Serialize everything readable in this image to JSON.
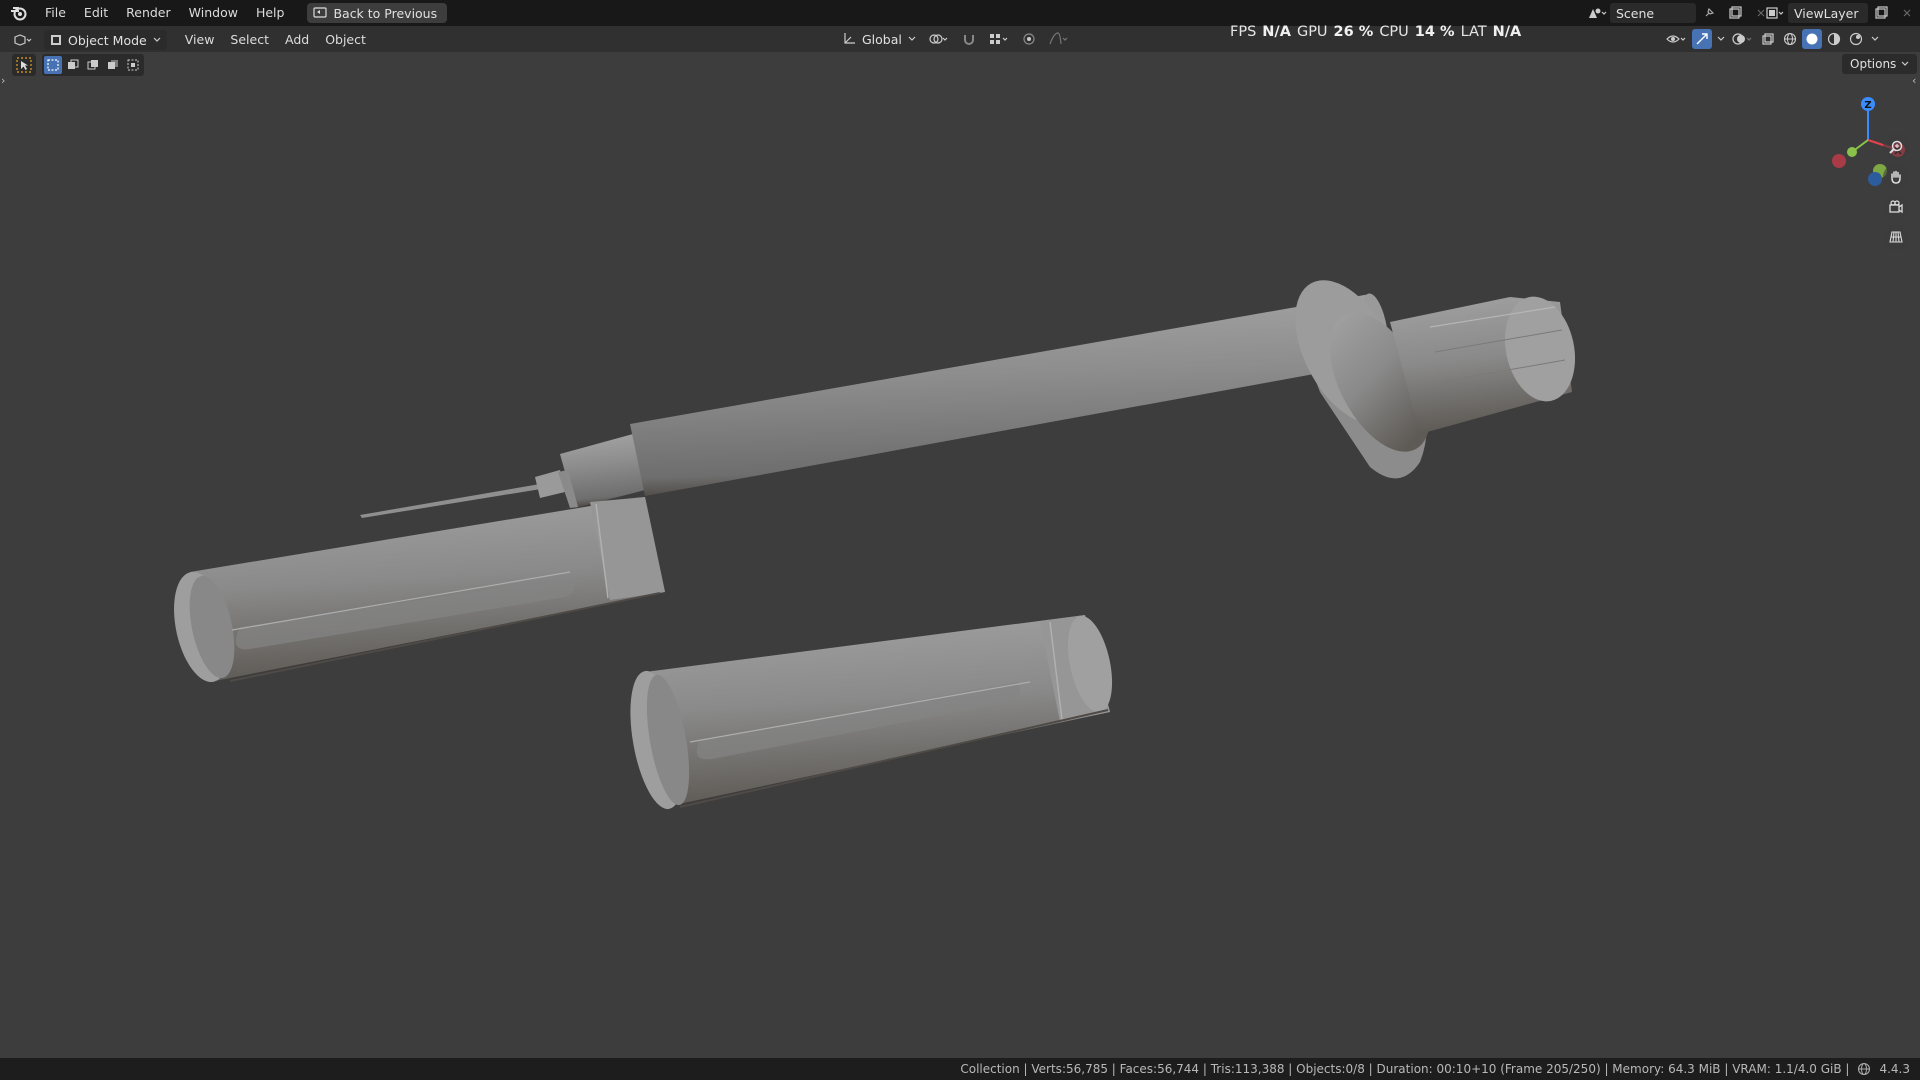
{
  "menubar": {
    "items": [
      "File",
      "Edit",
      "Render",
      "Window",
      "Help"
    ],
    "back_button": "Back to Previous",
    "scene": "Scene",
    "view_layer": "ViewLayer"
  },
  "viewport_header": {
    "mode": "Object Mode",
    "menu": [
      "View",
      "Select",
      "Add",
      "Object"
    ],
    "orientation": "Global"
  },
  "stats": {
    "fps_label": "FPS",
    "fps_value": "N/A",
    "gpu_label": "GPU",
    "gpu_value": "26 %",
    "cpu_label": "CPU",
    "cpu_value": "14 %",
    "lat_label": "LAT",
    "lat_value": "N/A"
  },
  "viewport": {
    "options": "Options",
    "gizmo": {
      "x": "X",
      "y": "Y",
      "z": "Z"
    }
  },
  "statusbar": {
    "text": "Collection | Verts:56,785 | Faces:56,744 | Tris:113,388 | Objects:0/8 | Duration: 00:10+10 (Frame 205/250) | Memory: 64.3 MiB | VRAM: 1.1/4.0 GiB |",
    "version": "4.4.3"
  },
  "colors": {
    "accent": "#4772b3",
    "axis_x": "#e8404e",
    "axis_y": "#8bc34a",
    "axis_z": "#3b8cff",
    "viewport_bg": "#3d3d3d",
    "mesh": "#8e8e8e"
  }
}
